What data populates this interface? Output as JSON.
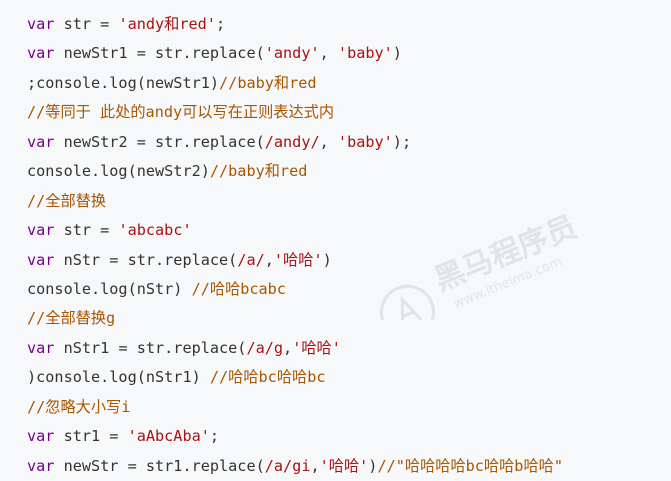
{
  "colors": {
    "background": "#f6f8fa",
    "keyword": "#770088",
    "string": "#aa1111",
    "comment": "#aa5500",
    "text": "#333333"
  },
  "watermark": {
    "icon": "heima-logo-icon",
    "brand_text": "黑马程序员",
    "url_text": "www.itheima.com"
  },
  "lines": [
    {
      "tokens": [
        {
          "t": "kw",
          "v": "var"
        },
        {
          "t": "plain",
          "v": " str = "
        },
        {
          "t": "str",
          "v": "'andy和red'"
        },
        {
          "t": "plain",
          "v": ";"
        }
      ]
    },
    {
      "tokens": [
        {
          "t": "kw",
          "v": "var"
        },
        {
          "t": "plain",
          "v": " newStr1 = str.replace("
        },
        {
          "t": "str",
          "v": "'andy'"
        },
        {
          "t": "plain",
          "v": ", "
        },
        {
          "t": "str",
          "v": "'baby'"
        },
        {
          "t": "plain",
          "v": ")"
        }
      ]
    },
    {
      "tokens": [
        {
          "t": "plain",
          "v": ";console.log(newStr1)"
        },
        {
          "t": "cm",
          "v": "//baby和red"
        }
      ]
    },
    {
      "tokens": [
        {
          "t": "cm",
          "v": "//等同于 此处的andy可以写在正则表达式内"
        }
      ]
    },
    {
      "tokens": [
        {
          "t": "kw",
          "v": "var"
        },
        {
          "t": "plain",
          "v": " newStr2 = str.replace("
        },
        {
          "t": "str",
          "v": "/andy/"
        },
        {
          "t": "plain",
          "v": ", "
        },
        {
          "t": "str",
          "v": "'baby'"
        },
        {
          "t": "plain",
          "v": ");"
        }
      ]
    },
    {
      "tokens": [
        {
          "t": "plain",
          "v": "console.log(newStr2)"
        },
        {
          "t": "cm",
          "v": "//baby和red"
        }
      ]
    },
    {
      "tokens": [
        {
          "t": "cm",
          "v": "//全部替换"
        }
      ]
    },
    {
      "tokens": [
        {
          "t": "kw",
          "v": "var"
        },
        {
          "t": "plain",
          "v": " str = "
        },
        {
          "t": "str",
          "v": "'abcabc'"
        }
      ]
    },
    {
      "tokens": [
        {
          "t": "kw",
          "v": "var"
        },
        {
          "t": "plain",
          "v": " nStr = str.replace("
        },
        {
          "t": "str",
          "v": "/a/"
        },
        {
          "t": "plain",
          "v": ","
        },
        {
          "t": "str",
          "v": "'哈哈'"
        },
        {
          "t": "plain",
          "v": ")"
        }
      ]
    },
    {
      "tokens": [
        {
          "t": "plain",
          "v": "console.log(nStr) "
        },
        {
          "t": "cm",
          "v": "//哈哈bcabc"
        }
      ]
    },
    {
      "tokens": [
        {
          "t": "cm",
          "v": "//全部替换g"
        }
      ]
    },
    {
      "tokens": [
        {
          "t": "kw",
          "v": "var"
        },
        {
          "t": "plain",
          "v": " nStr1 = str.replace("
        },
        {
          "t": "str",
          "v": "/a/g"
        },
        {
          "t": "plain",
          "v": ","
        },
        {
          "t": "str",
          "v": "'哈哈'"
        }
      ]
    },
    {
      "tokens": [
        {
          "t": "plain",
          "v": ")console.log(nStr1) "
        },
        {
          "t": "cm",
          "v": "//哈哈bc哈哈bc"
        }
      ]
    },
    {
      "tokens": [
        {
          "t": "cm",
          "v": "//忽略大小写i"
        }
      ]
    },
    {
      "tokens": [
        {
          "t": "kw",
          "v": "var"
        },
        {
          "t": "plain",
          "v": " str1 = "
        },
        {
          "t": "str",
          "v": "'aAbcAba'"
        },
        {
          "t": "plain",
          "v": ";"
        }
      ]
    },
    {
      "tokens": [
        {
          "t": "kw",
          "v": "var"
        },
        {
          "t": "plain",
          "v": " newStr = str1.replace("
        },
        {
          "t": "str",
          "v": "/a/gi"
        },
        {
          "t": "plain",
          "v": ","
        },
        {
          "t": "str",
          "v": "'哈哈'"
        },
        {
          "t": "plain",
          "v": ")"
        },
        {
          "t": "cm",
          "v": "//\"哈哈哈哈bc哈哈b哈哈\""
        }
      ]
    }
  ]
}
